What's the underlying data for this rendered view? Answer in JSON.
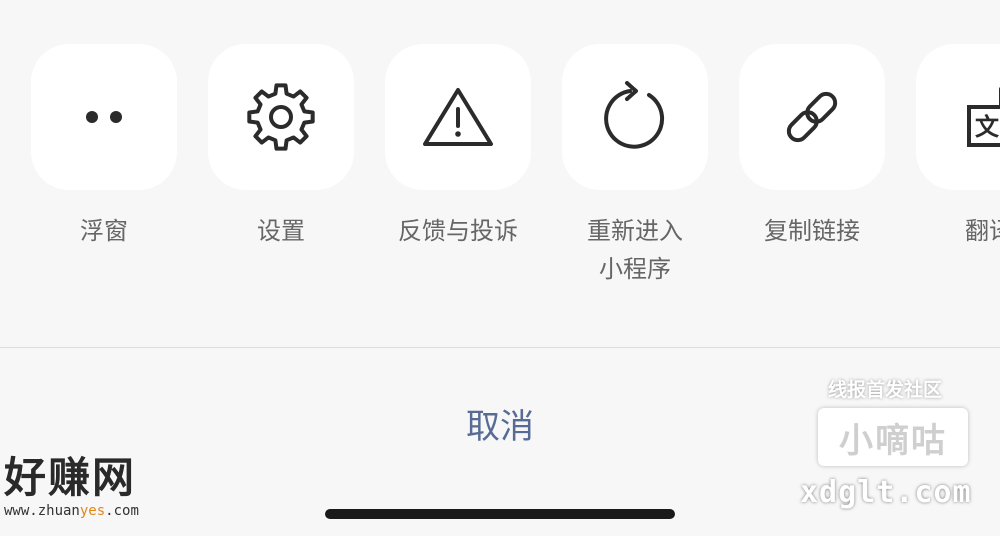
{
  "actions": [
    {
      "label": "浮窗",
      "icon": "dots-icon"
    },
    {
      "label": "设置",
      "icon": "gear-icon"
    },
    {
      "label": "反馈与投诉",
      "icon": "warning-icon"
    },
    {
      "label_line1": "重新进入",
      "label_line2": "小程序",
      "icon": "refresh-icon"
    },
    {
      "label": "复制链接",
      "icon": "link-icon"
    },
    {
      "label": "翻译",
      "icon": "translate-icon",
      "translate_glyph": "文"
    }
  ],
  "cancel_label": "取消",
  "colors": {
    "background": "#f7f7f7",
    "tile": "#ffffff",
    "label": "#666666",
    "cancel": "#576b95",
    "icon": "#2b2b2b"
  },
  "watermark_left": {
    "title": "好赚网",
    "url_prefix": "www.zhuan",
    "url_highlight": "yes",
    "url_suffix": ".com"
  },
  "watermark_right": {
    "top": "线报首发社区",
    "brand": "小嘀咕",
    "domain": "xdglt.com"
  }
}
